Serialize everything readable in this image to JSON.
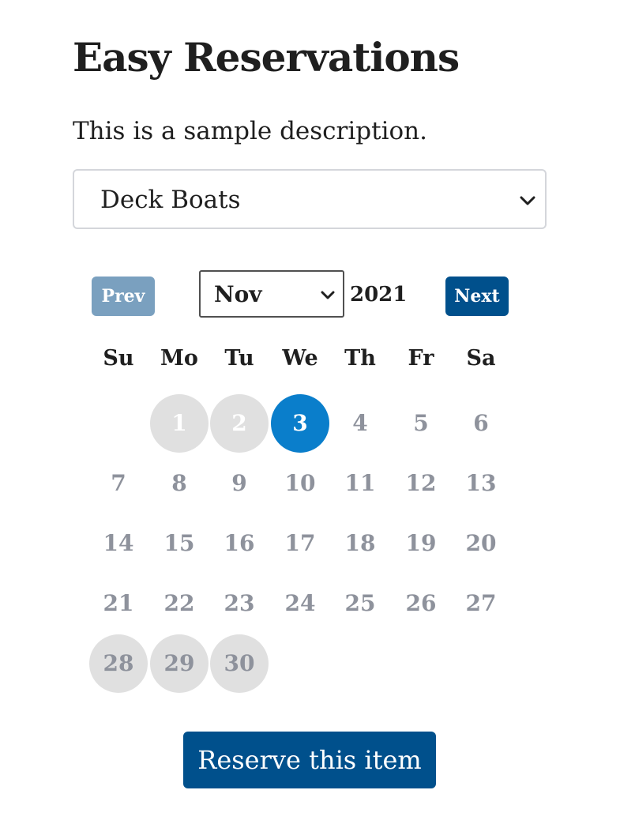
{
  "page": {
    "title": "Easy Reservations",
    "description": "This is a sample description."
  },
  "item_select": {
    "selected": "Deck Boats"
  },
  "calendar": {
    "prev_label": "Prev",
    "next_label": "Next",
    "month": "Nov",
    "year": "2021",
    "weekdays": [
      "Su",
      "Mo",
      "Tu",
      "We",
      "Th",
      "Fr",
      "Sa"
    ],
    "days": [
      "1",
      "2",
      "3",
      "4",
      "5",
      "6",
      "7",
      "8",
      "9",
      "10",
      "11",
      "12",
      "13",
      "14",
      "15",
      "16",
      "17",
      "18",
      "19",
      "20",
      "21",
      "22",
      "23",
      "24",
      "25",
      "26",
      "27",
      "28",
      "29",
      "30"
    ],
    "selected_day": "3"
  },
  "reserve_label": "Reserve this item",
  "colors": {
    "primary": "#00508c",
    "primary_disabled": "#7aa0bf",
    "today": "#0a7ecb",
    "past_day_bg": "#e0e0e0",
    "day_text": "#8e929c"
  }
}
